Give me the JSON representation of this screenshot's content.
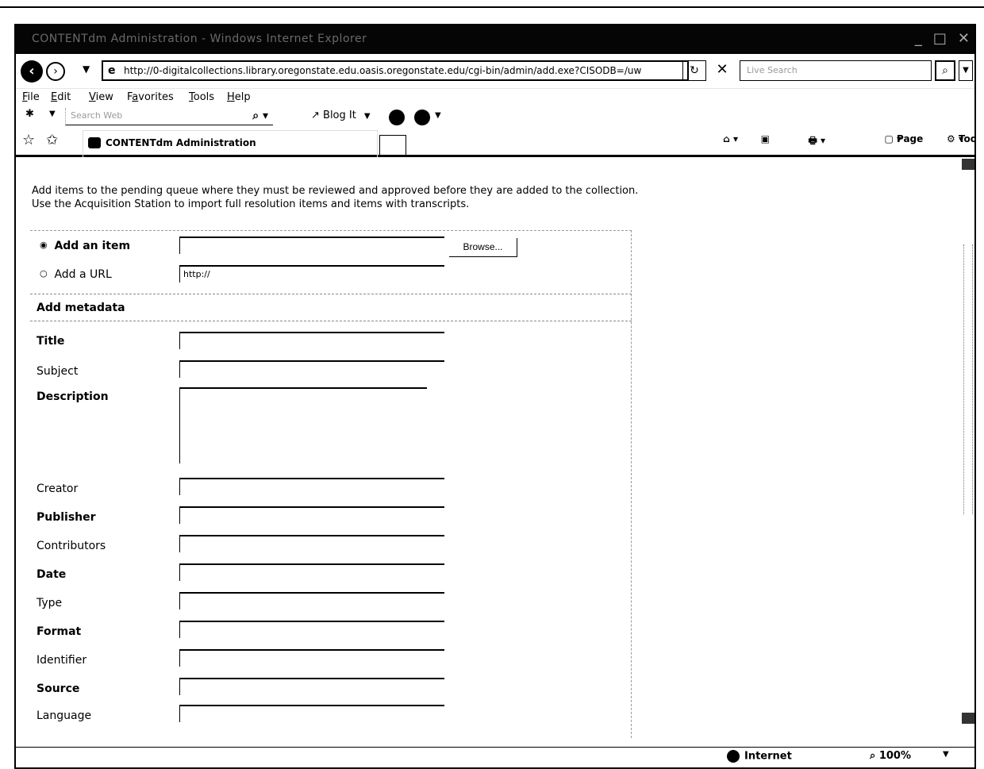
{
  "window": {
    "title": "CONTENTdm Administration - Windows Internet Explorer",
    "controls": [
      "_",
      "□",
      "✕"
    ]
  },
  "address": {
    "url": "http://0-digitalcollections.library.oregonstate.edu.oasis.oregonstate.edu/cgi-bin/admin/add.exe?CISODB=/uw",
    "search_placeholder": "Live Search"
  },
  "menu": {
    "items": [
      {
        "label": "File",
        "u": "F",
        "rest": "ile"
      },
      {
        "label": "Edit",
        "u": "E",
        "rest": "dit"
      },
      {
        "label": "View",
        "u": "V",
        "rest": "iew"
      },
      {
        "label": "Favorites",
        "pre": "F",
        "u": "a",
        "rest": "vorites"
      },
      {
        "label": "Tools",
        "u": "T",
        "rest": "ools"
      },
      {
        "label": "Help",
        "u": "H",
        "rest": "elp"
      }
    ]
  },
  "live_toolbar": {
    "search_placeholder": "Search Web",
    "blog_it_label": "Blog It"
  },
  "tabs": {
    "active_label": "CONTENTdm Administration"
  },
  "command_bar": {
    "page_label": "Page",
    "tools_label": "Tools"
  },
  "page": {
    "intro_line1": "Add items to the pending queue where they must be reviewed and approved before they are added to the collection.",
    "intro_line2": "Use the Acquisition Station to import full resolution items and items with transcripts.",
    "add_item_label": "Add an item",
    "add_url_label": "Add a URL",
    "browse_label": "Browse...",
    "url_value": "http://",
    "metadata_heading": "Add metadata",
    "fields": {
      "title": "Title",
      "subject": "Subject",
      "description": "Description",
      "creator": "Creator",
      "publisher": "Publisher",
      "contributors": "Contributors",
      "date": "Date",
      "type": "Type",
      "format": "Format",
      "identifier": "Identifier",
      "source": "Source",
      "language": "Language"
    }
  },
  "status": {
    "zone_label": "Internet",
    "zoom_label": "100%"
  }
}
